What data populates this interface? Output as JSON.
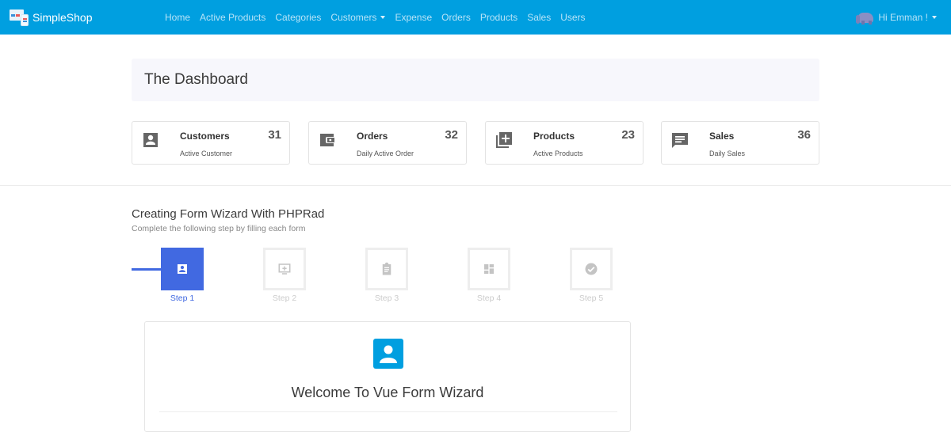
{
  "navbar": {
    "brand": "SimpleShop",
    "links": [
      {
        "label": "Home"
      },
      {
        "label": "Active Products"
      },
      {
        "label": "Categories"
      },
      {
        "label": "Customers",
        "dropdown": true
      },
      {
        "label": "Expense"
      },
      {
        "label": "Orders"
      },
      {
        "label": "Products"
      },
      {
        "label": "Sales"
      },
      {
        "label": "Users"
      }
    ],
    "user_greeting": "Hi Emman !",
    "colors": {
      "background": "#009fe0",
      "link": "#b7e3f7"
    }
  },
  "page": {
    "title": "The Dashboard"
  },
  "stats": [
    {
      "title": "Customers",
      "subtitle": "Active Customer",
      "value": "31",
      "icon": "account-box-icon"
    },
    {
      "title": "Orders",
      "subtitle": "Daily Active Order",
      "value": "32",
      "icon": "wallet-icon"
    },
    {
      "title": "Products",
      "subtitle": "Active Products",
      "value": "23",
      "icon": "library-add-icon"
    },
    {
      "title": "Sales",
      "subtitle": "Daily Sales",
      "value": "36",
      "icon": "message-text-icon"
    }
  ],
  "wizard": {
    "title": "Creating Form Wizard With PHPRad",
    "subtitle": "Complete the following step by filling each form",
    "active_step": 1,
    "accent": "#4169e1",
    "steps": [
      {
        "label": "Step 1",
        "icon": "account-box-icon",
        "active": true
      },
      {
        "label": "Step 2",
        "icon": "monitor-add-icon",
        "active": false
      },
      {
        "label": "Step 3",
        "icon": "clipboard-icon",
        "active": false
      },
      {
        "label": "Step 4",
        "icon": "dashboard-icon",
        "active": false
      },
      {
        "label": "Step 5",
        "icon": "check-circle-icon",
        "active": false
      }
    ],
    "panel": {
      "title": "Welcome To Vue Form Wizard",
      "icon": "account-box-icon",
      "icon_color": "#009fe0"
    }
  }
}
